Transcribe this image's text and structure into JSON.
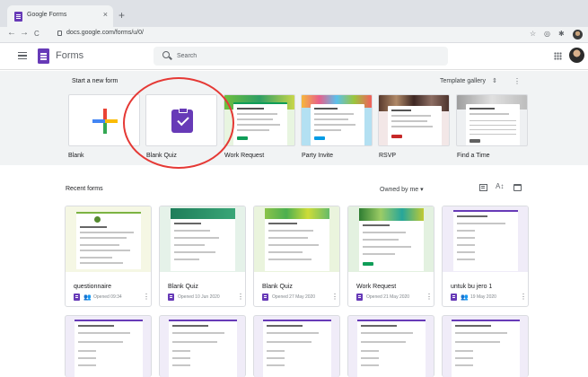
{
  "browser": {
    "tab_title": "Google Forms",
    "tab_close": "×",
    "new_tab": "+",
    "url": "docs.google.com/forms/u/0/",
    "nav": {
      "back": "←",
      "forward": "→",
      "reload": "C"
    },
    "toolbar_icons": {
      "star": "☆",
      "extension": "◎",
      "puzzle": "✱"
    }
  },
  "header": {
    "app_name": "Forms",
    "search_placeholder": "Search",
    "apps_icon": "apps-grid-icon"
  },
  "start": {
    "section_title": "Start a new form",
    "template_gallery": "Template gallery",
    "gallery_arrows": "⇕",
    "more": "⋮",
    "templates": [
      {
        "label": "Blank"
      },
      {
        "label": "Blank Quiz"
      },
      {
        "label": "Work Request"
      },
      {
        "label": "Party Invite"
      },
      {
        "label": "RSVP"
      },
      {
        "label": "Find a Time"
      }
    ]
  },
  "recent": {
    "section_title": "Recent forms",
    "owned_by": "Owned by me ▾",
    "row1": [
      {
        "name": "questionnaire",
        "date": "Opened 09:34",
        "shared": true
      },
      {
        "name": "Blank Quiz",
        "date": "Opened 10 Jun 2020",
        "shared": false
      },
      {
        "name": "Blank Quiz",
        "date": "Opened 27 May 2020",
        "shared": false
      },
      {
        "name": "Work Request",
        "date": "Opened 21 May 2020",
        "shared": false
      },
      {
        "name": "untuk bu jero 1",
        "date": "19 May 2020",
        "shared": true
      }
    ],
    "more": "⋮",
    "people": "👥"
  },
  "colors": {
    "forms_purple": "#673ab7",
    "annotation_red": "#e53935",
    "section_bg": "#f1f3f4"
  }
}
